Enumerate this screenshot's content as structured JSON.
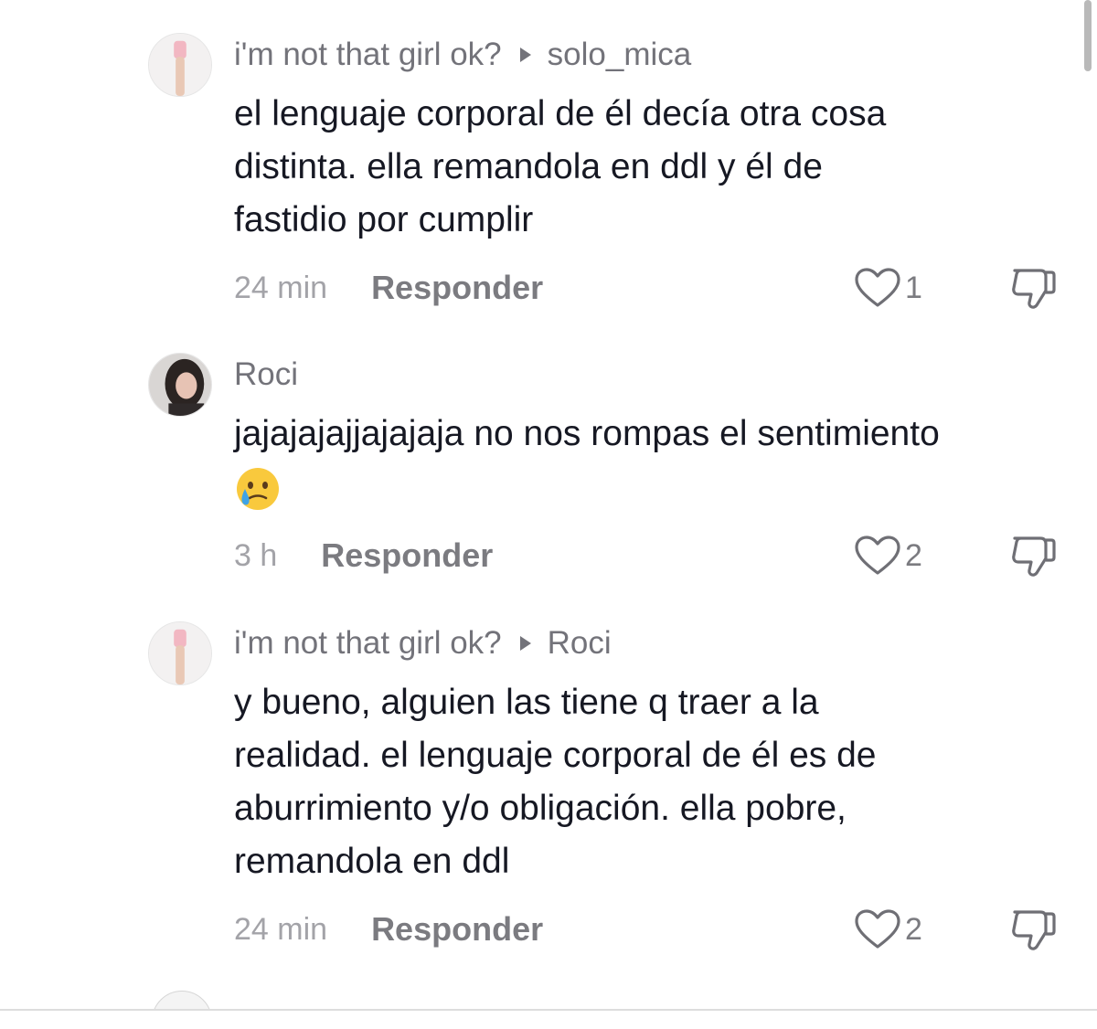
{
  "comments": [
    {
      "author": "i'm not that girl ok?",
      "reply_to": "solo_mica",
      "avatar": "hand-photo-avatar",
      "text_lines": [
        "el lenguaje corporal de él decía otra cosa",
        "distinta. ella remandola en ddl y él de",
        "fastidio por cumplir"
      ],
      "time": "24 min",
      "reply_label": "Responder",
      "likes": "1"
    },
    {
      "author": "Roci",
      "reply_to": "",
      "avatar": "woman-photo-avatar",
      "text_lines": [
        "jajajajajjajajaja no nos rompas el sentimiento"
      ],
      "emoji": "crying-face-emoji",
      "time": "3 h",
      "reply_label": "Responder",
      "likes": "2"
    },
    {
      "author": "i'm not that girl ok?",
      "reply_to": "Roci",
      "avatar": "hand-photo-avatar",
      "text_lines": [
        "y bueno, alguien las tiene q traer a la",
        "realidad. el lenguaje corporal de él es de",
        "aburrimiento y/o obligación. ella pobre,",
        "remandola en ddl"
      ],
      "time": "24 min",
      "reply_label": "Responder",
      "likes": "2"
    }
  ],
  "icons": {
    "like": "heart-outline-icon",
    "dislike": "thumbs-down-outline-icon",
    "reply": "reply-arrow-icon"
  },
  "colors": {
    "text": "#161823",
    "secondary": "#73737a",
    "time": "#a3a3a8"
  }
}
